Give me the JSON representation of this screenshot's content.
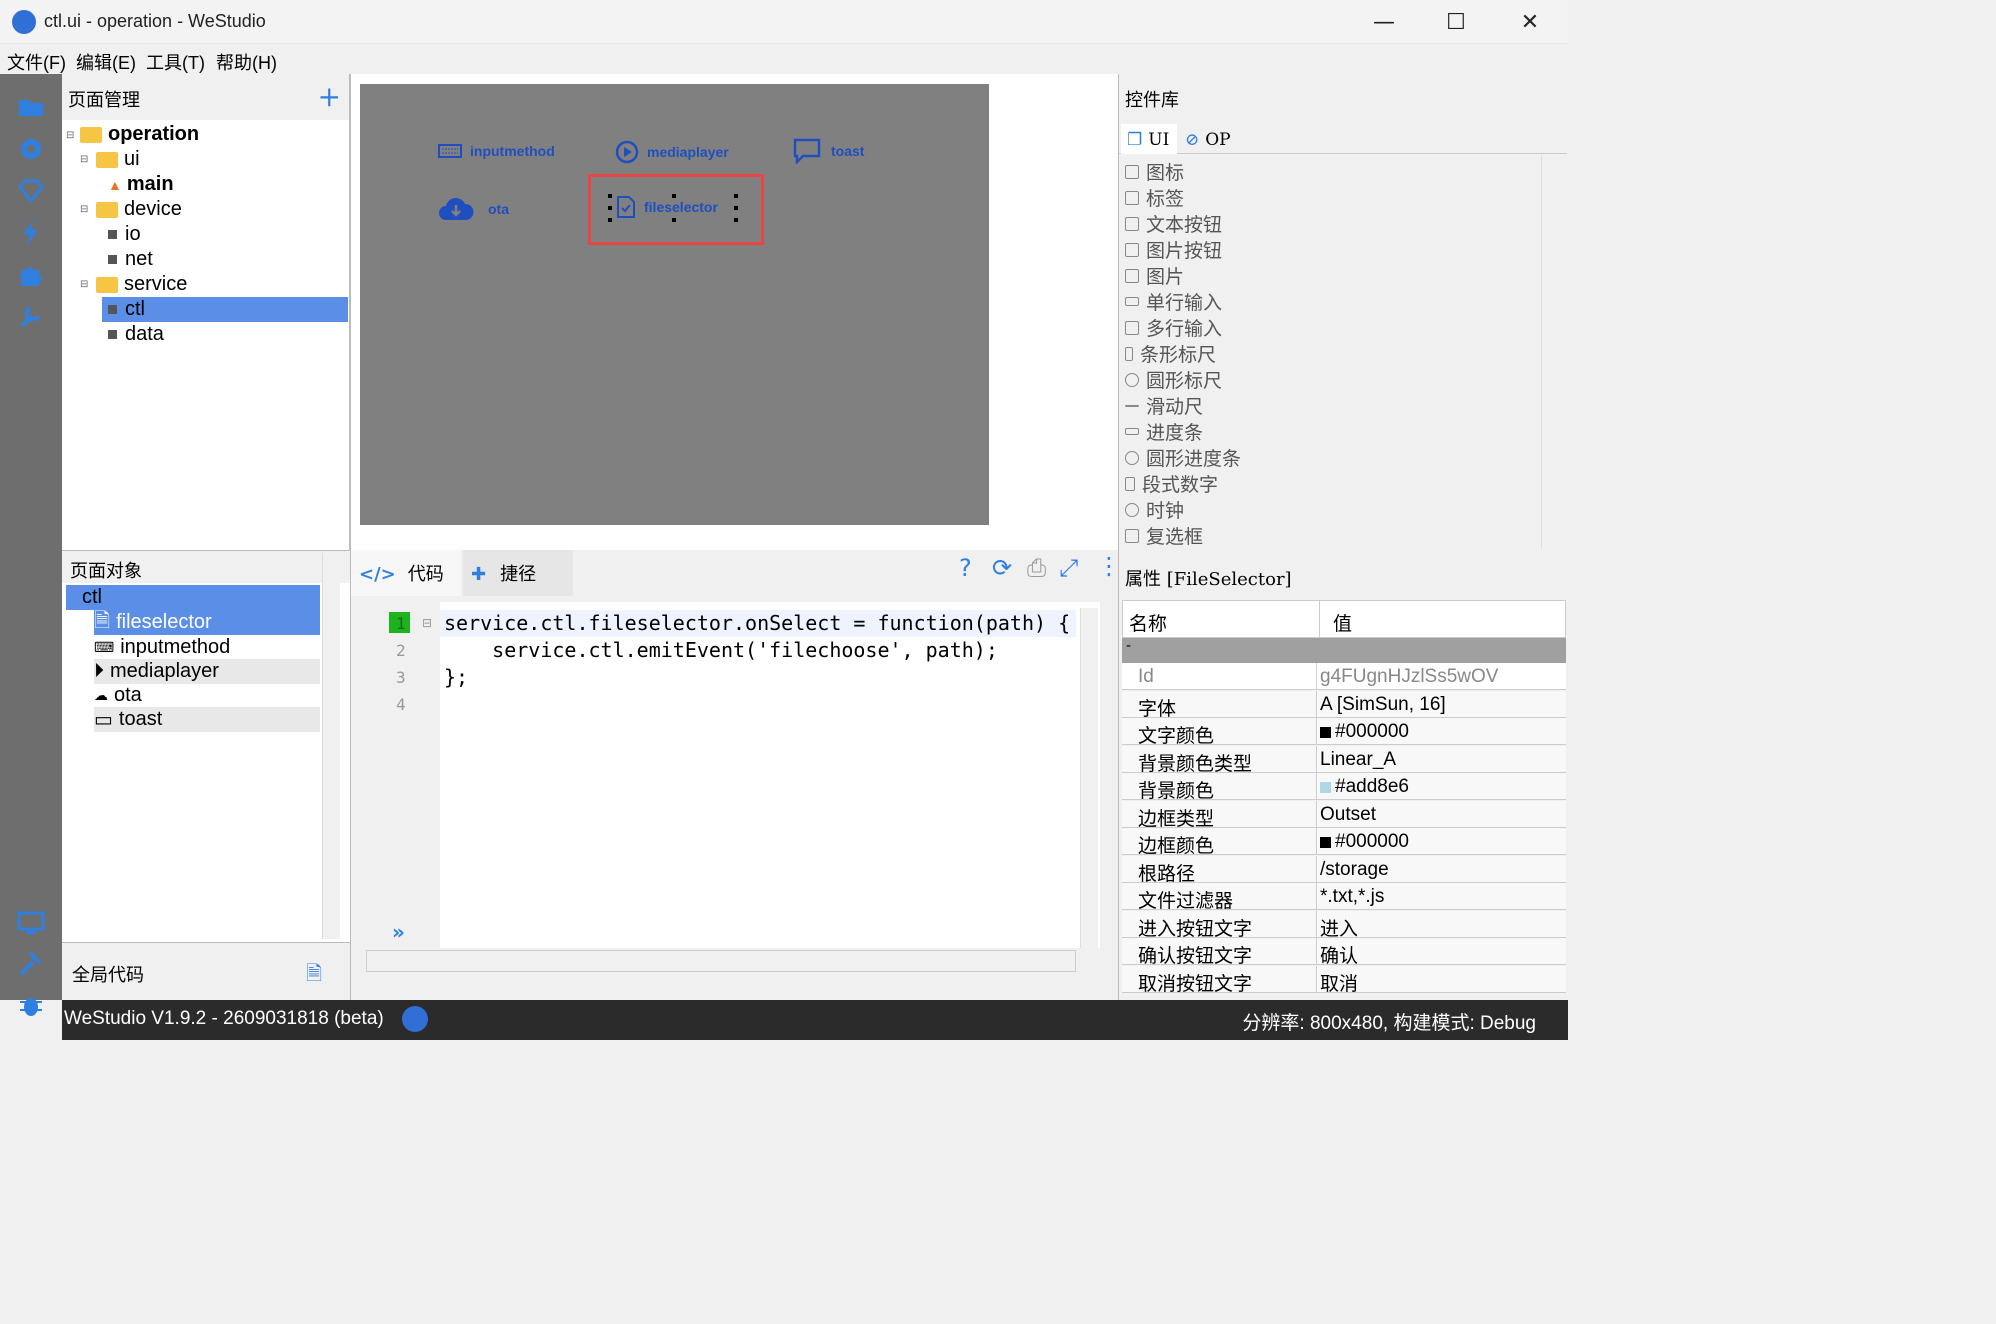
{
  "window": {
    "title": "ctl.ui - operation - WeStudio"
  },
  "menu": [
    "文件(F)",
    "编辑(E)",
    "工具(T)",
    "帮助(H)"
  ],
  "page_mgr": {
    "title": "页面管理",
    "tree": [
      "operation",
      "ui",
      "main",
      "device",
      "io",
      "net",
      "service",
      "ctl",
      "data"
    ]
  },
  "canvas": {
    "widgets": [
      "inputmethod",
      "mediaplayer",
      "toast",
      "ota",
      "fileselector"
    ]
  },
  "ctrl_lib": {
    "title": "控件库",
    "tabs": [
      "UI",
      "OP"
    ],
    "items": [
      "图标",
      "标签",
      "文本按钮",
      "图片按钮",
      "图片",
      "单行输入",
      "多行输入",
      "条形标尺",
      "圆形标尺",
      "滑动尺",
      "进度条",
      "圆形进度条",
      "段式数字",
      "时钟",
      "复选框"
    ]
  },
  "objects": {
    "title": "页面对象",
    "root": "ctl",
    "items": [
      "fileselector",
      "inputmethod",
      "mediaplayer",
      "ota",
      "toast"
    ]
  },
  "global_code": {
    "label": "全局代码"
  },
  "code_panel": {
    "tabs": [
      "代码",
      "捷径"
    ],
    "lines": [
      "service.ctl.fileselector.onSelect = function(path) {",
      "    service.ctl.emitEvent('filechoose', path);",
      "};",
      ""
    ],
    "line_numbers": [
      "1",
      "2",
      "3",
      "4"
    ]
  },
  "props": {
    "title": "属性 [FileSelector]",
    "col_name": "名称",
    "col_value": "值",
    "group": "-",
    "rows": [
      {
        "name": "Id",
        "value": "g4FUgnHJzlSs5wOV"
      },
      {
        "name": "字体",
        "value": "A [SimSun, 16]"
      },
      {
        "name": "文字颜色",
        "value": "#000000",
        "swatch": "#000000"
      },
      {
        "name": "背景颜色类型",
        "value": "Linear_A"
      },
      {
        "name": "背景颜色",
        "value": "#add8e6",
        "swatch": "#add8e6"
      },
      {
        "name": "边框类型",
        "value": "Outset"
      },
      {
        "name": "边框颜色",
        "value": "#000000",
        "swatch": "#000000"
      },
      {
        "name": "根路径",
        "value": "/storage"
      },
      {
        "name": "文件过滤器",
        "value": "*.txt,*.js"
      },
      {
        "name": "进入按钮文字",
        "value": "进入"
      },
      {
        "name": "确认按钮文字",
        "value": "确认"
      },
      {
        "name": "取消按钮文字",
        "value": "取消"
      }
    ]
  },
  "status": {
    "left": "WeStudio V1.9.2 - 2609031818 (beta)",
    "right": "分辨率: 800x480, 构建模式: Debug"
  },
  "colors": {
    "accent": "#4a7fd8",
    "selection": "#5b8ee6",
    "canvas": "#808080"
  }
}
